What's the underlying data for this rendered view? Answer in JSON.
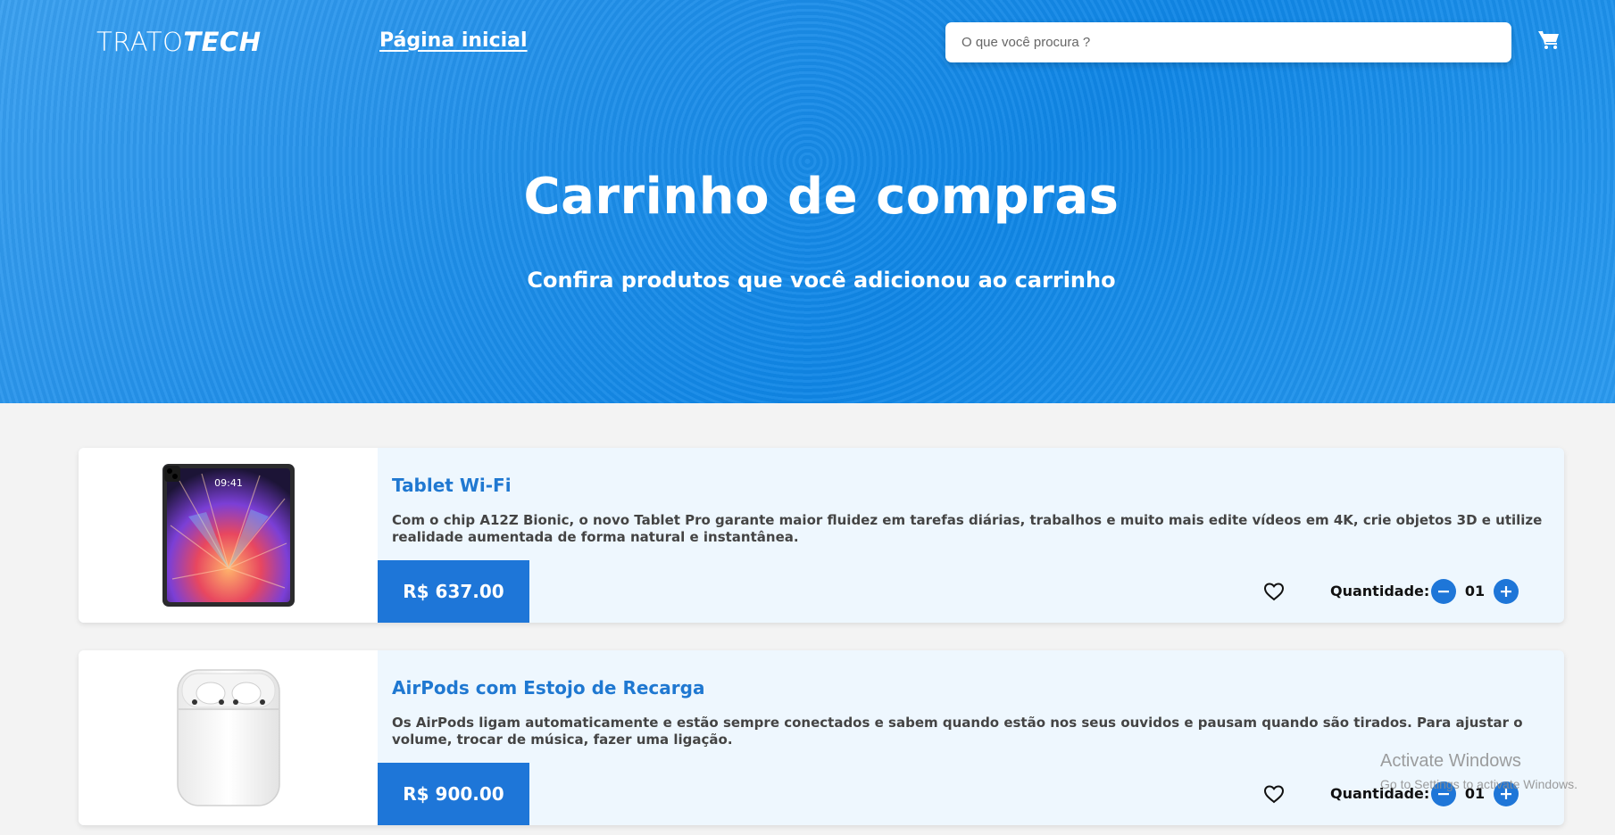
{
  "header": {
    "logo_part1": "TRATO",
    "logo_part2": "TECH",
    "nav_home": "Página inicial",
    "search_placeholder": "O que você procura ?",
    "cart_icon": "cart-icon"
  },
  "hero": {
    "title": "Carrinho de compras",
    "subtitle": "Confira produtos que você adicionou ao carrinho"
  },
  "cart": {
    "items": [
      {
        "title": "Tablet Wi-Fi",
        "description": "Com o chip A12Z Bionic, o novo Tablet Pro garante maior fluidez em tarefas diárias, trabalhos e muito mais edite vídeos em 4K, crie objetos 3D e utilize realidade aumentada de forma natural e instantânea.",
        "price": "R$ 637.00",
        "quantity_label": "Quantidade:",
        "quantity": "01",
        "image": "tablet-image"
      },
      {
        "title": "AirPods com Estojo de Recarga",
        "description": "Os AirPods ligam automaticamente e estão sempre conectados e sabem quando estão nos seus ouvidos e pausam quando são tirados. Para ajustar o volume, trocar de música, fazer uma ligação.",
        "price": "R$ 900.00",
        "quantity_label": "Quantidade:",
        "quantity": "01",
        "image": "airpods-image"
      }
    ]
  },
  "tablet_screen_time": "09:41",
  "watermark": {
    "line1": "Activate Windows",
    "line2": "Go to Settings to activate Windows."
  },
  "colors": {
    "accent": "#1e76d8",
    "hero_blue": "#1e8ee9",
    "card_bg": "#eef7fe"
  }
}
